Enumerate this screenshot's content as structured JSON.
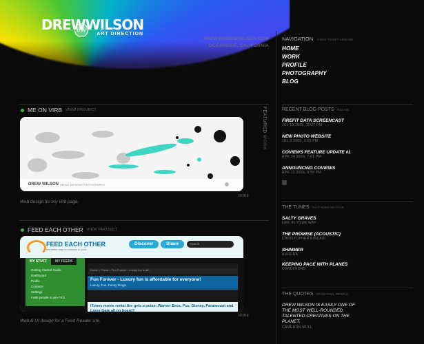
{
  "logo": {
    "name": "DREWWILSON",
    "subtitle": "ART DIRECTION",
    "badge": "BW"
  },
  "contact": {
    "email": "DREW@DREWWILSON.COM",
    "location": "OCEANSIDE, CALIFORNIA"
  },
  "navigation": {
    "heading": "NAVIGATION",
    "subheading": "A WAY TO GET AROUND",
    "items": [
      "HOME",
      "WORK",
      "PROFILE",
      "PHOTOGRAPHY",
      "BLOG"
    ]
  },
  "featured": {
    "label": "FEATURED",
    "sublabel": "WORK"
  },
  "sections": [
    {
      "title": "ME ON VIRB",
      "view": "VIEW PROJECT",
      "caption": "Web design for my Virb page.",
      "card_name": "DREW WILSON",
      "card_links": "ABOUT  DESIGNS  PHOTOGRAPHS",
      "more": "MORE"
    },
    {
      "title": "FEED EACH OTHER",
      "view": "VIEW PROJECT",
      "caption": "Web & UI design for a Feed Reader site.",
      "more": "MORE"
    }
  ],
  "feed": {
    "title": "FEED EACH OTHER",
    "tagline": "the better way to connect to your...",
    "discover": "Discover",
    "share": "Share",
    "search": "Search",
    "tabs": [
      "MY STUFF",
      "MY FEEDS"
    ],
    "left_rows": [
      "Getting Started Guide",
      "Dashboard",
      "Profile",
      "Contacts",
      "Settings",
      "Invite people to join FEO"
    ],
    "breadcrumb": "Home > Feeds > Fun Forever - Luxury fun is aff...",
    "story_title": "Fun Forever - Luxury fun is affordable for everyone!",
    "story_sub": "Luxury, Fun, Funny things",
    "item": "iTunes movie rental fire gets a pulse: Warner Bros, Fox, Disney, Paramount and Lions Gate all on board?"
  },
  "blog": {
    "heading": "RECENT BLOG POSTS",
    "sub": "RSS ME",
    "posts": [
      {
        "title": "FIREFIT DATA SCREENCAST",
        "date": "JUL 18 2009, 11:27 PM"
      },
      {
        "title": "NEW PHOTO WEBSITE",
        "date": "JUL 3 2009, 3:15 PM"
      },
      {
        "title": "COVIEWS FEATURE UPDATE #1",
        "date": "APR 24 2009, 7:01 PM"
      },
      {
        "title": "ANNOUNCING COVIEWS",
        "date": "APR 22 2009, 9:58 PM"
      }
    ]
  },
  "tunes": {
    "heading": "THE TUNES",
    "sub": "THAT ROCK MY FACE",
    "items": [
      {
        "title": "SALTY GRAVES",
        "artist": "LIFE IN YOUR WAY"
      },
      {
        "title": "THE PROMISE (ACOUSTIC)",
        "artist": "CHRISTOPHER KINCAID"
      },
      {
        "title": "SHIMMER",
        "artist": "AURORA"
      },
      {
        "title": "KEEPING PACE WITH PLANES",
        "artist": "CONDITIONS"
      }
    ]
  },
  "quotes": {
    "heading": "THE QUOTES",
    "sub": "FROM COOL PEOPLE",
    "text": "DREW WILSON IS EASILY ONE OF THE MOST WELL-ROUNDED, TALENTED CREATIVES ON THE PLANET.",
    "author": "CAMERON MOLL"
  }
}
